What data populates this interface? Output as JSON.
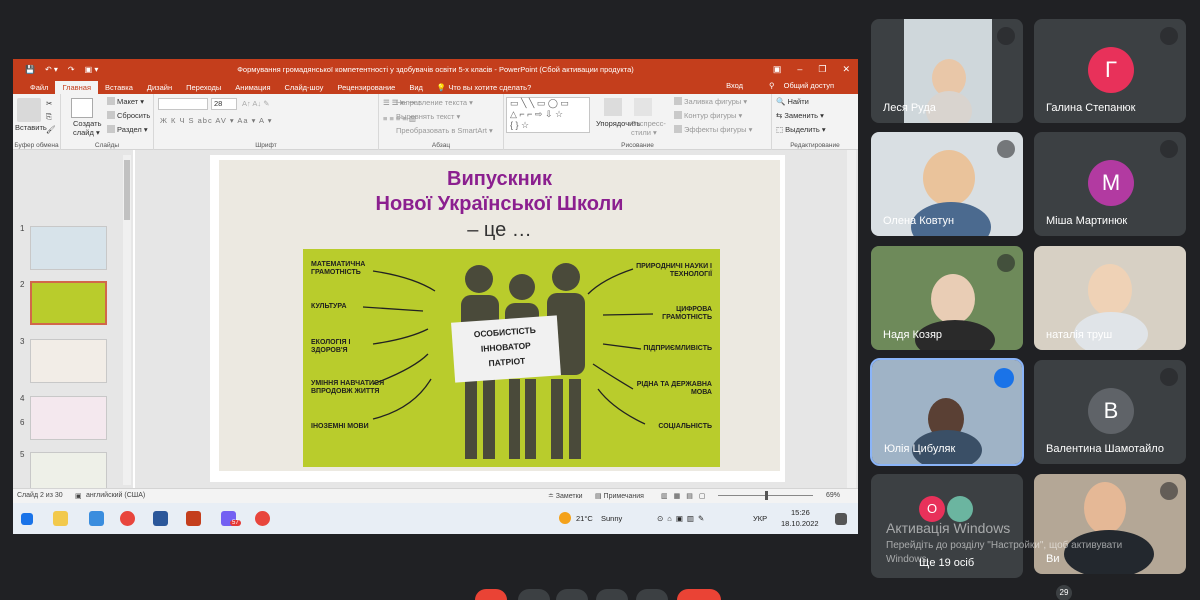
{
  "powerpoint": {
    "window_title": "Формування громадянської компетентності у здобувачів освіти 5-х класів - PowerPoint (Сбой активации продукта)",
    "qat": [
      "💾",
      "↶ ▾",
      "↷",
      "▣ ▾"
    ],
    "window_controls": [
      "▣",
      "–",
      "❐",
      "✕"
    ],
    "tabs": [
      "Файл",
      "Главная",
      "Вставка",
      "Дизайн",
      "Переходы",
      "Анимация",
      "Слайд-шоу",
      "Рецензирование",
      "Вид",
      "💡 Что вы хотите сделать?"
    ],
    "active_tab": "Главная",
    "login": "Вход",
    "share": "Общий доступ",
    "ribbon": {
      "paste": "Вставить",
      "clipboard_group": "Буфер обмена",
      "new_slide": "Создать слайд ▾",
      "layout": "Макет ▾",
      "reset": "Сбросить",
      "section": "Раздел ▾",
      "slides_group": "Слайды",
      "font_size": "28",
      "font_group": "Шрифт",
      "font_buttons": "Ж К Ч S abc AV ▾ Aa ▾ A ▾",
      "text_direction": "Направление текста ▾",
      "align_text": "Выровнять текст ▾",
      "smartart": "Преобразовать в SmartArt ▾",
      "paragraph_group": "Абзац",
      "arrange": "Упорядочить",
      "quick_styles": "Экспресс-стили ▾",
      "shape_fill": "Заливка фигуры ▾",
      "shape_outline": "Контур фигуры ▾",
      "shape_effects": "Эффекты фигуры ▾",
      "drawing_group": "Рисование",
      "find": "Найти",
      "replace": "Заменить ▾",
      "select": "Выделить ▾",
      "editing_group": "Редактирование"
    },
    "thumb_numbers": [
      "1",
      "2",
      "3",
      "4",
      "5",
      "6"
    ],
    "slide": {
      "title_line1": "Випускник",
      "title_line2": "Нової Української Школи",
      "title_line3": "– це …",
      "sign": [
        "ОСОБИСТІСТЬ",
        "ІННОВАТОР",
        "ПАТРІОТ"
      ],
      "left_labels": [
        "МАТЕМАТИЧНА ГРАМОТНІСТЬ",
        "КУЛЬТУРА",
        "ЕКОЛОГІЯ І ЗДОРОВ'Я",
        "УМІННЯ НАВЧАТИСЯ ВПРОДОВЖ ЖИТТЯ",
        "ІНОЗЕМНІ МОВИ"
      ],
      "right_labels": [
        "ПРИРОДНИЧІ НАУКИ І ТЕХНОЛОГІЇ",
        "ЦИФРОВА ГРАМОТНІСТЬ",
        "ПІДПРИЄМЛИВІСТЬ",
        "РІДНА ТА ДЕРЖАВНА МОВА",
        "СОЦІАЛЬНІСТЬ"
      ]
    },
    "status": {
      "slide_info": "Слайд 2 из 30",
      "language": "английский (США)",
      "notes": "≐ Заметки",
      "comments": "▤ Примечания",
      "zoom": "69%"
    },
    "taskbar": {
      "weather_temp": "21°C",
      "weather_desc": "Sunny",
      "language": "УКР",
      "time": "15:26",
      "date": "18.10.2022",
      "badge_viber": "57"
    }
  },
  "participants": [
    {
      "name": "Леся Руда"
    },
    {
      "name": "Галина Степанюк",
      "initial": "Г"
    },
    {
      "name": "Олена Ковтун"
    },
    {
      "name": "Міша Мартинюк",
      "initial": "М"
    },
    {
      "name": "Надя Козяр"
    },
    {
      "name": "наталія труш"
    },
    {
      "name": "Юлія Цибуляк"
    },
    {
      "name": "Валентина Шамотайло",
      "initial": "В"
    },
    {
      "name": "Ще 19 осіб",
      "initial": "О"
    },
    {
      "name": "Ви"
    }
  ],
  "watermark": {
    "title": "Активація Windows",
    "line1": "Перейдіть до розділу \"Настройки\", щоб активувати",
    "line2": "Windows."
  },
  "bottom_count": "29",
  "colors": {
    "meet_bg": "#202124",
    "tile_bg": "#3c4043",
    "ppt_red": "#c43e1c",
    "slide_purple": "#8b1f8f",
    "slide_green": "#b9cc2c"
  }
}
